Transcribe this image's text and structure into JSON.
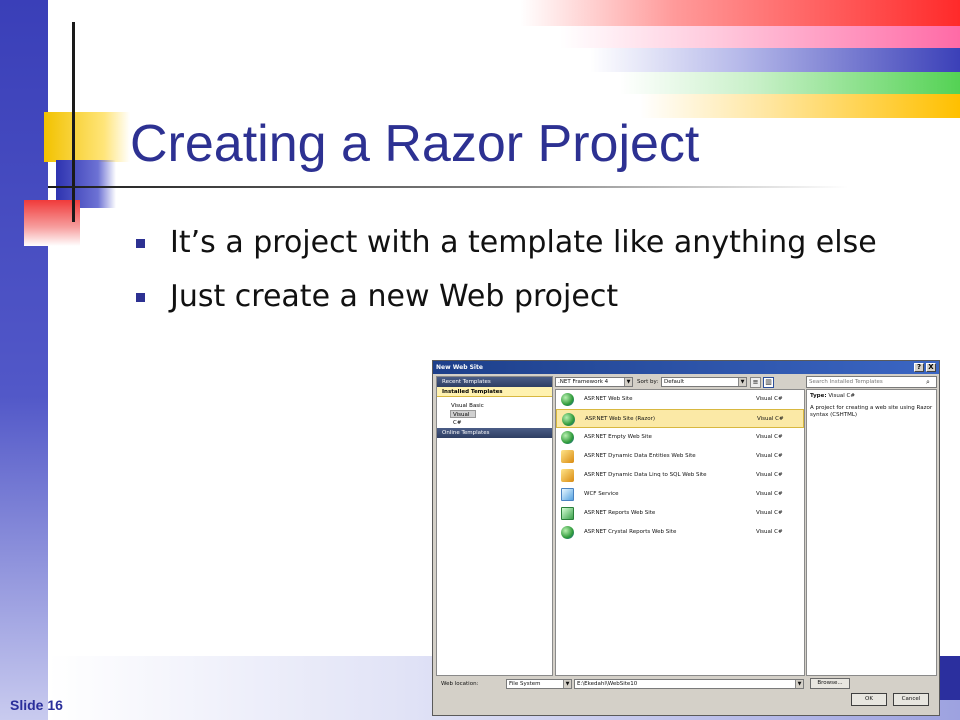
{
  "slide": {
    "title": "Creating a Razor Project",
    "bullets": [
      "It’s a project with a template like anything else",
      "Just create a new Web project"
    ],
    "footer": "Slide 16"
  },
  "dialog": {
    "title": "New Web Site",
    "help_button": "?",
    "close_button": "X",
    "left_pane": {
      "recent": "Recent Templates",
      "installed": "Installed Templates",
      "languages": [
        "Visual Basic",
        "Visual C#"
      ],
      "online": "Online Templates"
    },
    "framework": ".NET Framework 4",
    "sort_label": "Sort by:",
    "sort_value": "Default",
    "search_placeholder": "Search Installed Templates",
    "templates": [
      {
        "name": "ASP.NET Web Site",
        "lang": "Visual C#"
      },
      {
        "name": "ASP.NET Web Site (Razor)",
        "lang": "Visual C#"
      },
      {
        "name": "ASP.NET Empty Web Site",
        "lang": "Visual C#"
      },
      {
        "name": "ASP.NET Dynamic Data Entities Web Site",
        "lang": "Visual C#"
      },
      {
        "name": "ASP.NET Dynamic Data Linq to SQL Web Site",
        "lang": "Visual C#"
      },
      {
        "name": "WCF Service",
        "lang": "Visual C#"
      },
      {
        "name": "ASP.NET Reports Web Site",
        "lang": "Visual C#"
      },
      {
        "name": "ASP.NET Crystal Reports Web Site",
        "lang": "Visual C#"
      }
    ],
    "details": {
      "type_label": "Type:",
      "type_value": "Visual C#",
      "description": "A project for creating a web site using Razor syntax (CSHTML)"
    },
    "web_location_label": "Web location:",
    "web_location_type": "File System",
    "web_location_path": "E:\\Ekedahl\\WebSite10",
    "browse": "Browse...",
    "ok": "OK",
    "cancel": "Cancel"
  }
}
